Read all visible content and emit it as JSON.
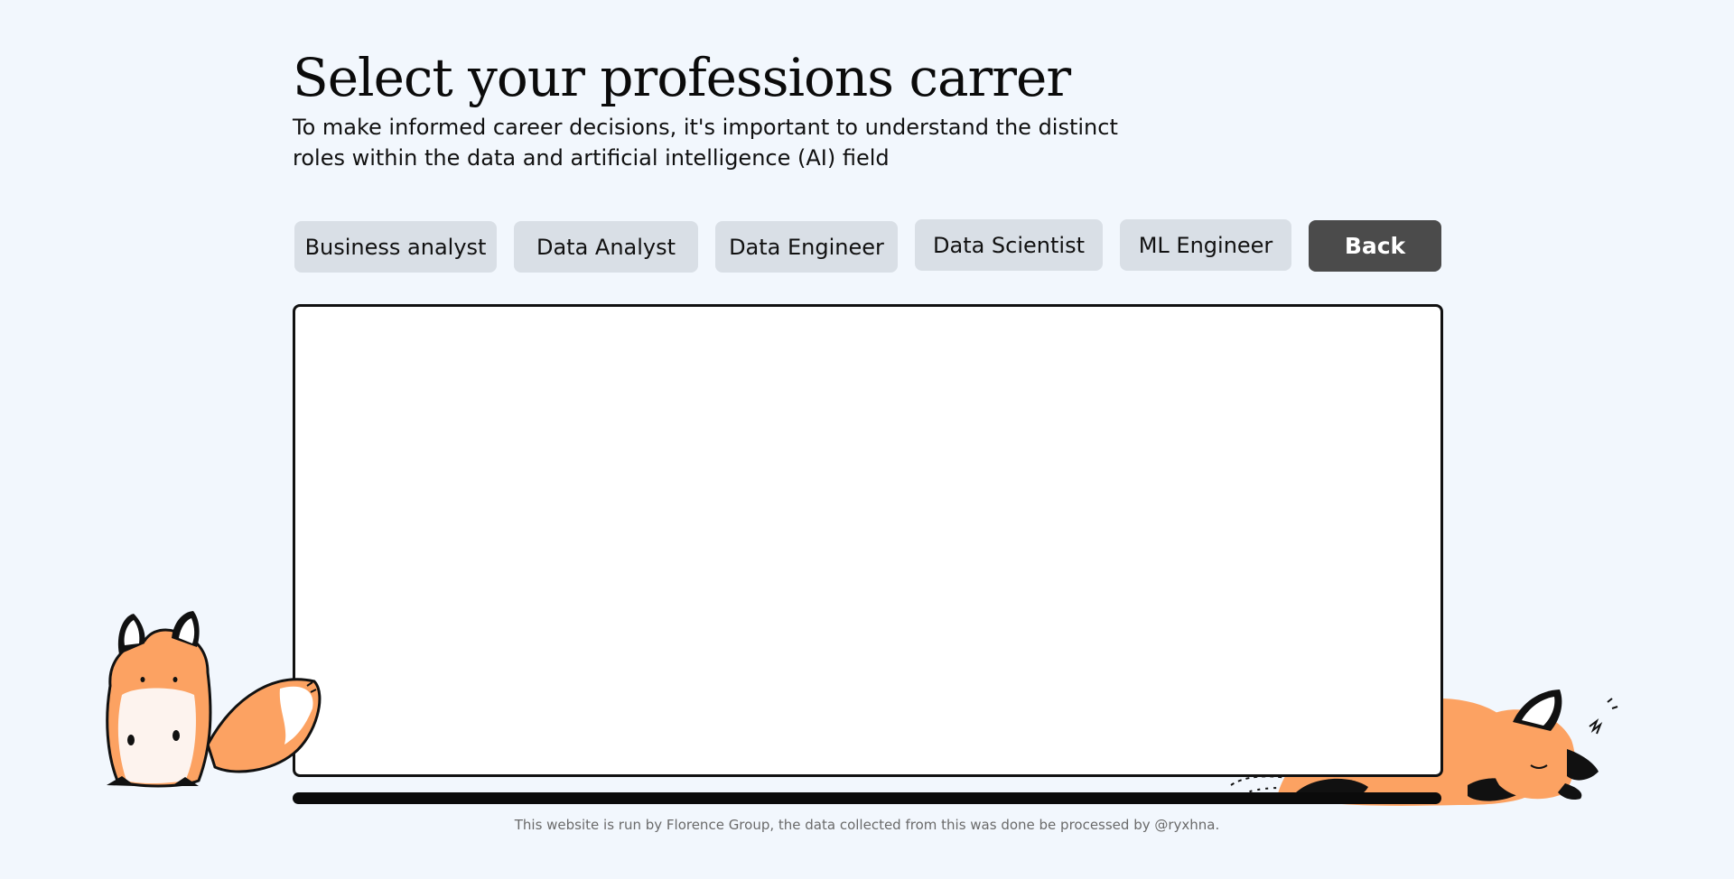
{
  "header": {
    "title": "Select your professions carrer",
    "subtitle": "To make informed career decisions, it's important to understand the distinct roles within the data and artificial intelligence (AI) field"
  },
  "roles": [
    {
      "label": "Business analyst"
    },
    {
      "label": "Data Analyst"
    },
    {
      "label": "Data Engineer"
    },
    {
      "label": "Data Scientist"
    },
    {
      "label": "ML Engineer"
    }
  ],
  "back_label": "Back",
  "footer": {
    "text": "This website is run by Florence Group, the data collected from this was done be processed by @ryxhna."
  },
  "colors": {
    "background": "#f2f7fd",
    "role_button": "#d9dfe6",
    "back_button": "#4b4b4b",
    "fox_orange": "#fca262"
  },
  "icons": {
    "left_mascot": "sitting-fox-illustration",
    "right_mascot": "sleeping-fox-illustration"
  }
}
